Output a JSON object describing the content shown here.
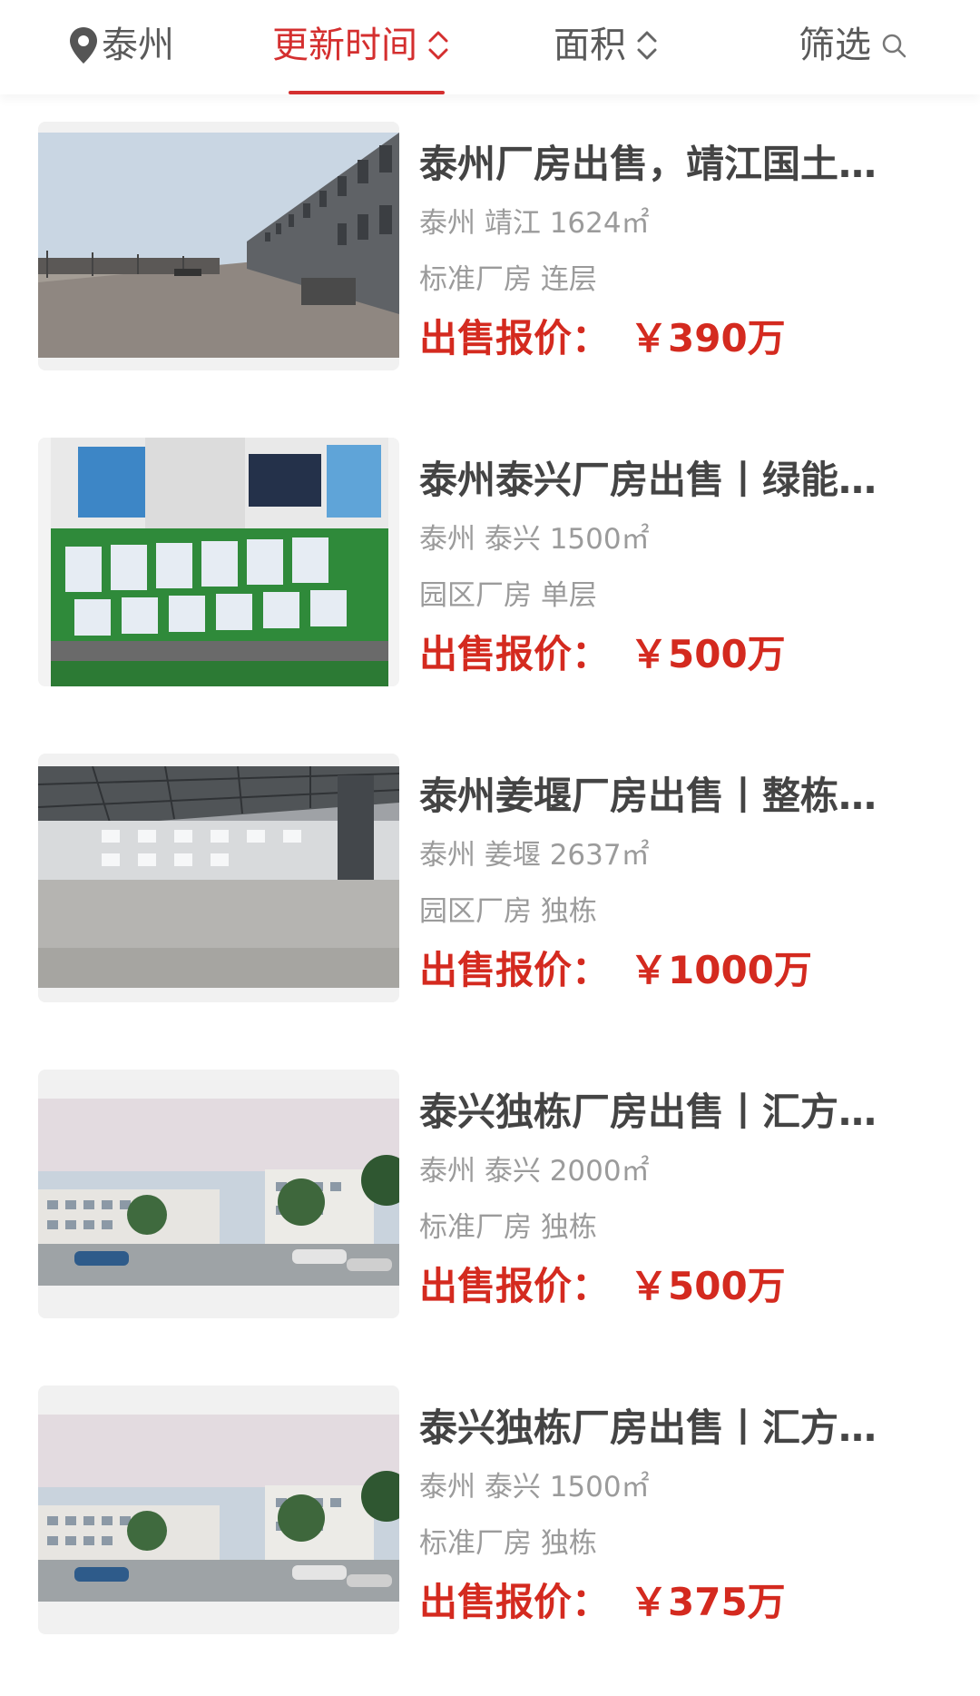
{
  "filters": {
    "city": {
      "label": "泰州",
      "icon": "location-pin-icon"
    },
    "time": {
      "label": "更新时间",
      "icon": "sort-arrows-icon",
      "active": true
    },
    "area": {
      "label": "面积",
      "icon": "sort-arrows-icon"
    },
    "filter": {
      "label": "筛选",
      "icon": "search-icon"
    }
  },
  "colors": {
    "accent": "#d42f2f",
    "price": "#d42a1f",
    "title": "#444444",
    "meta": "#9b9b9b"
  },
  "listings": [
    {
      "title": "泰州厂房出售，靖江国土…",
      "location": "泰州 靖江 1624㎡",
      "type": "标准厂房 连层",
      "price_label": "出售报价：",
      "price_value": "￥390万",
      "image": "factory-exterior-street-photo"
    },
    {
      "title": "泰州泰兴厂房出售丨绿能…",
      "location": "泰州 泰兴 1500㎡",
      "type": "园区厂房 单层",
      "price_label": "出售报价：",
      "price_value": "￥500万",
      "image": "industrial-park-scale-model-photo"
    },
    {
      "title": "泰州姜堰厂房出售丨整栋…",
      "location": "泰州 姜堰 2637㎡",
      "type": "园区厂房 独栋",
      "price_label": "出售报价：",
      "price_value": "￥1000万",
      "image": "empty-warehouse-interior-photo"
    },
    {
      "title": "泰兴独栋厂房出售丨汇方…",
      "location": "泰州 泰兴 2000㎡",
      "type": "标准厂房 独栋",
      "price_label": "出售报价：",
      "price_value": "￥500万",
      "image": "building-rendering-photo"
    },
    {
      "title": "泰兴独栋厂房出售丨汇方…",
      "location": "泰州 泰兴 1500㎡",
      "type": "标准厂房 独栋",
      "price_label": "出售报价：",
      "price_value": "￥375万",
      "image": "building-rendering-photo"
    }
  ]
}
